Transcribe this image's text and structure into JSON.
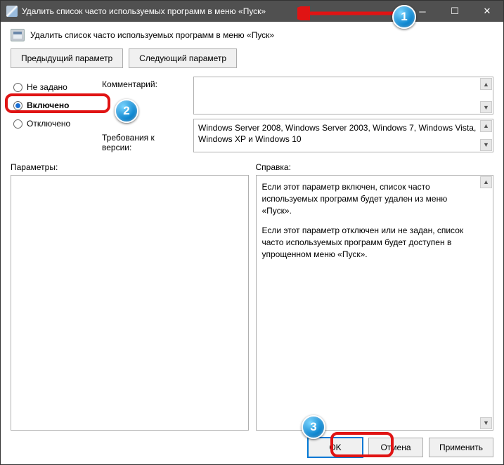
{
  "titlebar": {
    "title": "Удалить список часто используемых программ в меню «Пуск»"
  },
  "subtitle": "Удалить список часто используемых программ в меню «Пуск»",
  "nav": {
    "prev": "Предыдущий параметр",
    "next": "Следующий параметр"
  },
  "radios": {
    "not_configured": "Не задано",
    "enabled": "Включено",
    "disabled": "Отключено"
  },
  "labels": {
    "comment": "Комментарий:",
    "supported": "Требования к версии:",
    "params": "Параметры:",
    "help": "Справка:"
  },
  "supported_text": "Windows Server 2008, Windows Server 2003, Windows 7, Windows Vista, Windows XP и Windows 10",
  "help": {
    "p1": "Если этот параметр включен, список часто используемых программ будет удален из меню «Пуск».",
    "p2": "Если этот параметр отключен или не задан, список часто используемых программ будет доступен в упрощенном меню «Пуск»."
  },
  "buttons": {
    "ok": "OK",
    "cancel": "Отмена",
    "apply": "Применить"
  },
  "steps": {
    "s1": "1",
    "s2": "2",
    "s3": "3"
  }
}
